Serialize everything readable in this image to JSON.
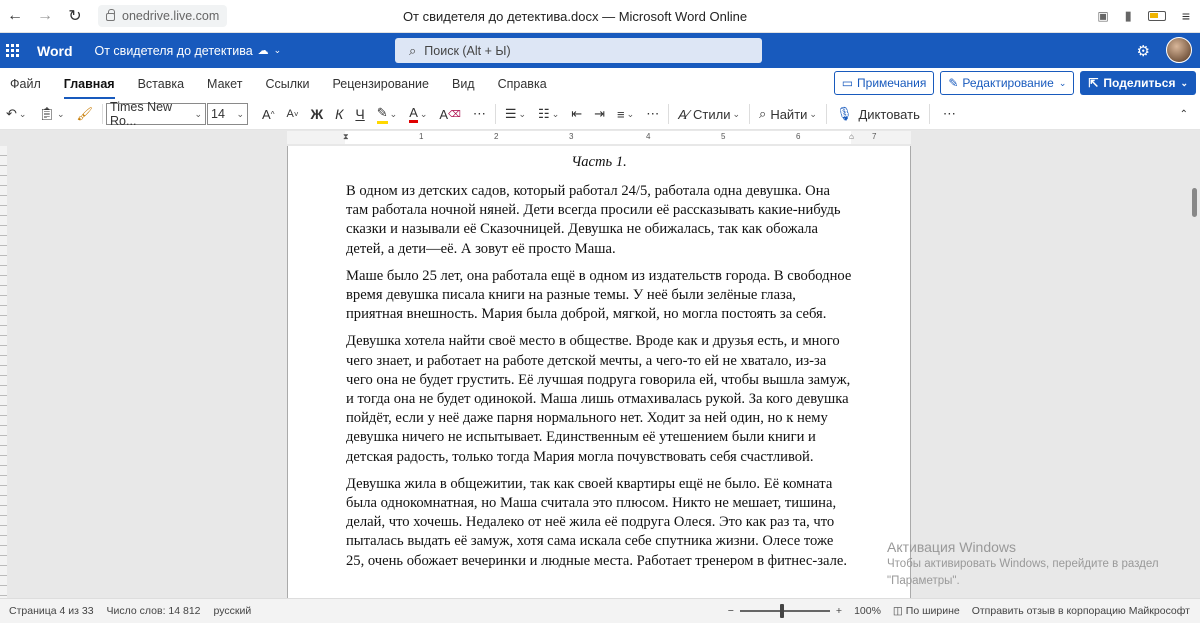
{
  "browser": {
    "url": "onedrive.live.com",
    "window_title": "От свидетеля до детектива.docx — Microsoft Word Online"
  },
  "app": {
    "name": "Word",
    "doc_name": "От свидетеля до детектива",
    "search_placeholder": "Поиск (Alt + Ы)"
  },
  "tabs": [
    "Файл",
    "Главная",
    "Вставка",
    "Макет",
    "Ссылки",
    "Рецензирование",
    "Вид",
    "Справка"
  ],
  "tab_buttons": {
    "comments": "Примечания",
    "editing": "Редактирование",
    "share": "Поделиться"
  },
  "ribbon": {
    "font": "Times New Ro...",
    "size": "14",
    "bold": "Ж",
    "italic": "К",
    "underline": "Ч",
    "styles": "Стили",
    "find": "Найти",
    "dictate": "Диктовать"
  },
  "ruler": [
    "1",
    "2",
    "3",
    "4",
    "5",
    "6",
    "7"
  ],
  "document": {
    "heading": "Часть 1.",
    "paragraphs": [
      "В одном из детских садов, который работал 24/5, работала одна девушка. Она там работала ночной няней. Дети всегда просили её рассказывать какие-нибудь сказки и называли её Сказочницей. Девушка не обижалась, так как обожала детей, а дети—её. А зовут её просто Маша.",
      "Маше было 25 лет, она работала ещё в одном из издательств города. В свободное время девушка писала книги на разные темы. У неё были зелёные глаза, приятная внешность. Мария была доброй, мягкой, но могла постоять за себя.",
      "Девушка хотела найти своё место в обществе. Вроде как и друзья есть, и много чего знает, и работает на работе детской мечты, а чего-то ей не хватало, из-за чего она не будет грустить. Её лучшая подруга говорила ей, чтобы вышла замуж, и тогда она не будет одинокой. Маша лишь отмахивалась рукой. За кого девушка пойдёт, если у неё даже парня нормального нет. Ходит за ней один, но к нему девушка ничего не испытывает. Единственным её утешением были книги и детская радость, только тогда Мария могла почувствовать себя счастливой.",
      "Девушка жила в общежитии, так как своей квартиры ещё не было. Её комната была однокомнатная, но Маша считала это плюсом. Никто не мешает, тишина, делай, что хочешь. Недалеко от неё жила её подруга Олеся. Это как раз та, что пыталась выдать её замуж, хотя сама искала себе спутника жизни. Олесе тоже 25, очень обожает вечеринки и людные места. Работает тренером в фитнес-зале."
    ]
  },
  "activation": {
    "title": "Активация Windows",
    "line1": "Чтобы активировать Windows, перейдите в раздел",
    "line2": "\"Параметры\"."
  },
  "status": {
    "page": "Страница 4 из 33",
    "words": "Число слов: 14 812",
    "language": "русский",
    "zoom": "100%",
    "fit": "По ширине",
    "feedback": "Отправить отзыв в корпорацию Майкрософт"
  }
}
